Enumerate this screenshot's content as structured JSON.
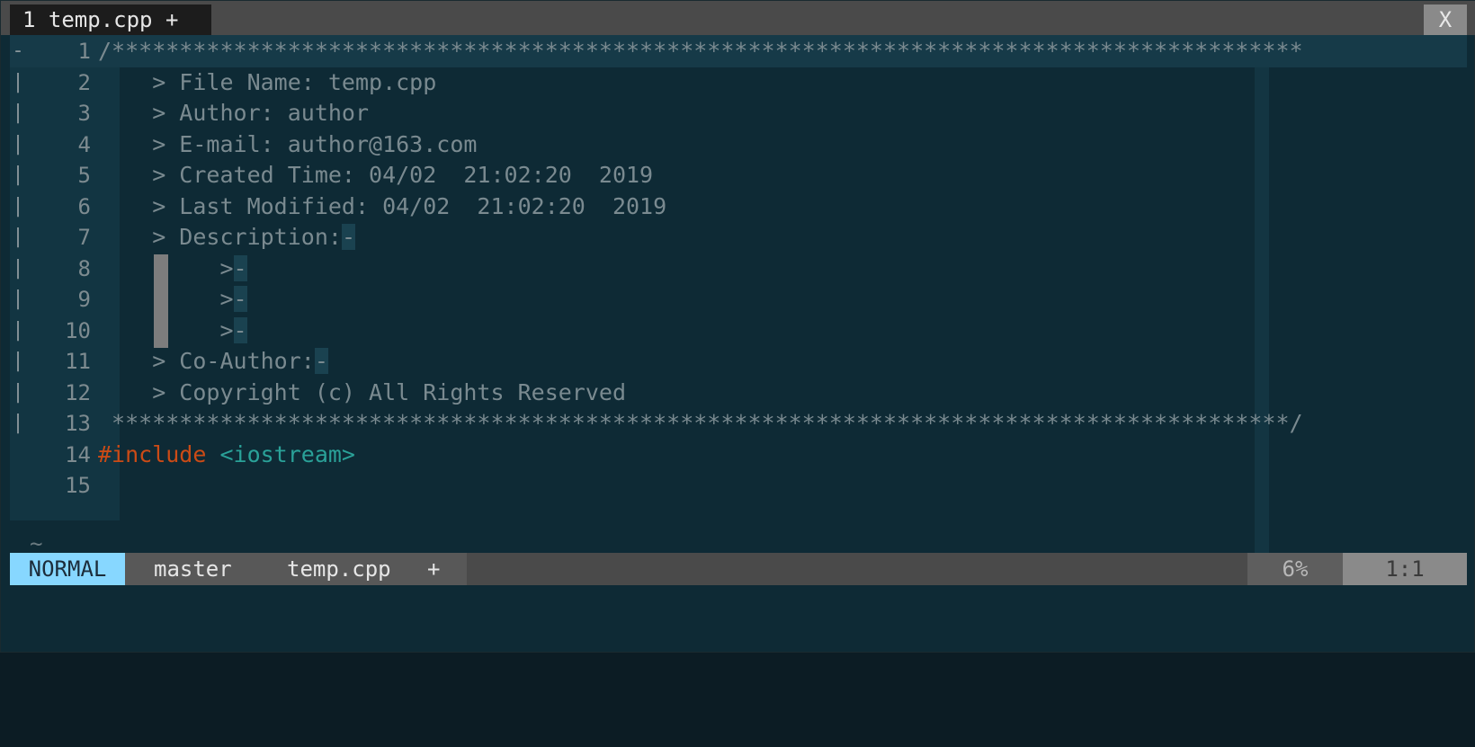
{
  "tabline": {
    "active_tab": "1 temp.cpp +",
    "close_label": "X"
  },
  "editor": {
    "lines": [
      {
        "num": "1",
        "fold": "-",
        "segments": [
          {
            "text": "/****************************************************************************************",
            "cls": "c-comment"
          }
        ]
      },
      {
        "num": "2",
        "fold": "|",
        "segments": [
          {
            "text": "    > File Name: temp.cpp",
            "cls": "c-comment"
          }
        ]
      },
      {
        "num": "3",
        "fold": "|",
        "segments": [
          {
            "text": "    > Author: author",
            "cls": "c-comment"
          }
        ]
      },
      {
        "num": "4",
        "fold": "|",
        "segments": [
          {
            "text": "    > E-mail: author@163.com",
            "cls": "c-comment"
          }
        ]
      },
      {
        "num": "5",
        "fold": "|",
        "segments": [
          {
            "text": "    > Created Time: 04/02  21:02:20  2019",
            "cls": "c-comment"
          }
        ]
      },
      {
        "num": "6",
        "fold": "|",
        "segments": [
          {
            "text": "    > Last Modified: 04/02  21:02:20  2019",
            "cls": "c-comment"
          }
        ]
      },
      {
        "num": "7",
        "fold": "|",
        "segments": [
          {
            "text": "    > Description:",
            "cls": "c-comment"
          },
          {
            "text": "-",
            "cls": "trail"
          }
        ]
      },
      {
        "num": "8",
        "fold": "|",
        "segments": [
          {
            "text": "         >",
            "cls": "c-comment"
          },
          {
            "text": "-",
            "cls": "trail"
          }
        ]
      },
      {
        "num": "9",
        "fold": "|",
        "segments": [
          {
            "text": "         >",
            "cls": "c-comment"
          },
          {
            "text": "-",
            "cls": "trail"
          }
        ]
      },
      {
        "num": "10",
        "fold": "|",
        "segments": [
          {
            "text": "         >",
            "cls": "c-comment"
          },
          {
            "text": "-",
            "cls": "trail"
          }
        ]
      },
      {
        "num": "11",
        "fold": "|",
        "segments": [
          {
            "text": "    > Co-Author:",
            "cls": "c-comment"
          },
          {
            "text": "-",
            "cls": "trail"
          }
        ]
      },
      {
        "num": "12",
        "fold": "|",
        "segments": [
          {
            "text": "    > Copyright (c) All Rights Reserved",
            "cls": "c-comment"
          }
        ]
      },
      {
        "num": "13",
        "fold": "|",
        "segments": [
          {
            "text": " ***************************************************************************************/",
            "cls": "c-comment"
          }
        ]
      },
      {
        "num": "14",
        "fold": "",
        "segments": [
          {
            "text": "#include ",
            "cls": "c-preproc"
          },
          {
            "text": "<iostream>",
            "cls": "c-header"
          }
        ]
      },
      {
        "num": "15",
        "fold": "",
        "segments": []
      }
    ],
    "tilde": "~"
  },
  "statusline": {
    "mode": "NORMAL",
    "branch": "master",
    "filename": "temp.cpp",
    "modified_flag": "+",
    "percent": "6%",
    "position": "1:1"
  },
  "colors": {
    "background": "#0e2a35",
    "comment": "#7a8a90",
    "preproc": "#cb4b16",
    "header": "#2aa198",
    "mode_bg": "#87d7ff"
  }
}
